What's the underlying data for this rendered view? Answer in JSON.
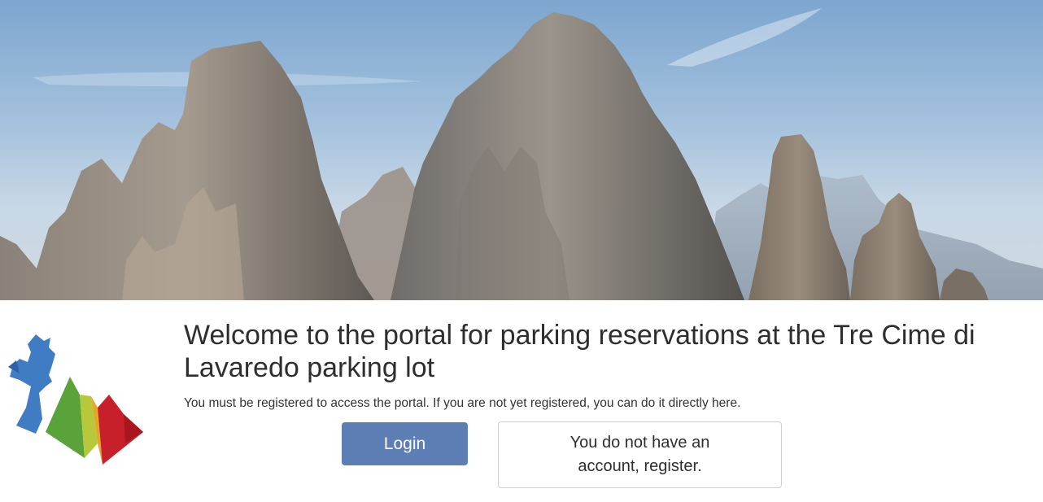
{
  "hero": {
    "image": "mountain-peaks-image"
  },
  "logo": {
    "icon": "rooster-mountains-logo",
    "colors": [
      "#3f7cc4",
      "#5aa33b",
      "#b7c93b",
      "#e3a72a",
      "#c8202a"
    ]
  },
  "main": {
    "title": "Welcome to the portal for parking reservations at the Tre Cime di Lavaredo parking lot",
    "subtitle": "You must be registered to access the portal. If you are not yet registered, you can do it directly here.",
    "login_label": "Login",
    "register_label": "You do not have an account, register."
  },
  "colors": {
    "login_button": "#5d7db5",
    "text": "#2e2e2e"
  }
}
